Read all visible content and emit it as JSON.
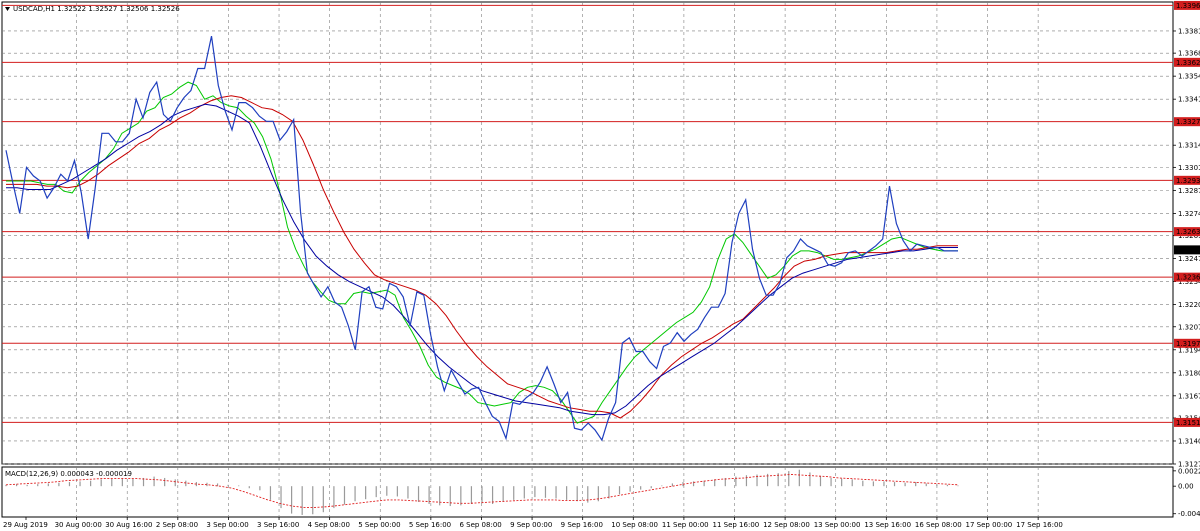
{
  "window": {
    "info": "USDCAD,H1  1.32522 1.32527 1.32506 1.32526",
    "menu_icon": "triangle-down-icon"
  },
  "colors": {
    "price": "#1f3fbf",
    "ma_fast": "#00c800",
    "ma_mid": "#c80000",
    "ma_slow": "#0000a0",
    "hline": "#d21e1e",
    "grid": "#7f7f7f",
    "label_bg": "#d21e1e",
    "current_bg": "#000000",
    "macd": "#9a9a9a",
    "macd_signal": "#e02020"
  },
  "chart_data": [
    {
      "type": "line",
      "symbol": "USDCAD",
      "timeframe": "H1",
      "ohlc": {
        "open": 1.32522,
        "high": 1.32527,
        "low": 1.32506,
        "close": 1.32526
      },
      "ylim": [
        1.3127,
        1.3398
      ],
      "y_ticks": [
        1.3381,
        1.3368,
        1.33545,
        1.3341,
        1.3314,
        1.3301,
        1.32875,
        1.3274,
        1.3261,
        1.32475,
        1.3234,
        1.32205,
        1.32075,
        1.3194,
        1.31805,
        1.3167,
        1.3154,
        1.31405,
        1.3127
      ],
      "y_tick_labels": [
        "1.33810",
        "1.33680",
        "1.33545",
        "1.33410",
        "1.33140",
        "1.33010",
        "1.32875",
        "1.32740",
        "1.32610",
        "1.32475",
        "1.32340",
        "1.32205",
        "1.32075",
        "1.31940",
        "1.31805",
        "1.31670",
        "1.31540",
        "1.31405",
        "1.31270"
      ],
      "x_labels": [
        "29 Aug 2019",
        "30 Aug 00:00",
        "30 Aug 16:00",
        "2 Sep 08:00",
        "3 Sep 00:00",
        "3 Sep 16:00",
        "4 Sep 08:00",
        "5 Sep 00:00",
        "5 Sep 16:00",
        "6 Sep 08:00",
        "9 Sep 00:00",
        "9 Sep 16:00",
        "10 Sep 08:00",
        "11 Sep 00:00",
        "11 Sep 16:00",
        "12 Sep 08:00",
        "13 Sep 00:00",
        "13 Sep 16:00",
        "16 Sep 08:00",
        "17 Sep 00:00",
        "17 Sep 16:00"
      ],
      "horizontal_levels": [
        {
          "value": 1.3396,
          "label": "1.33960"
        },
        {
          "value": 1.33626,
          "label": "1.33626"
        },
        {
          "value": 1.33278,
          "label": "1.33278"
        },
        {
          "value": 1.32934,
          "label": "1.32934"
        },
        {
          "value": 1.32633,
          "label": "1.32633"
        },
        {
          "value": 1.32366,
          "label": "1.32366"
        },
        {
          "value": 1.31978,
          "label": "1.31978"
        },
        {
          "value": 1.31514,
          "label": "1.31514"
        }
      ],
      "current_price": {
        "value": 1.32526,
        "label": "1.32526"
      },
      "series": [
        {
          "role": "price",
          "values": [
            1.3311,
            1.3292,
            1.3274,
            1.3301,
            1.3296,
            1.3293,
            1.3283,
            1.3289,
            1.3297,
            1.3293,
            1.3305,
            1.3286,
            1.3259,
            1.3288,
            1.3321,
            1.3321,
            1.3316,
            1.3316,
            1.3321,
            1.3341,
            1.333,
            1.3345,
            1.3351,
            1.3332,
            1.3328,
            1.3336,
            1.3342,
            1.3346,
            1.3359,
            1.3359,
            1.3378,
            1.3349,
            1.3334,
            1.3323,
            1.3339,
            1.3339,
            1.3336,
            1.3331,
            1.3328,
            1.3328,
            1.3317,
            1.3322,
            1.3329,
            1.3275,
            1.3239,
            1.3232,
            1.3225,
            1.3231,
            1.3222,
            1.3219,
            1.3208,
            1.3194,
            1.3228,
            1.3231,
            1.3219,
            1.3218,
            1.3233,
            1.3231,
            1.3225,
            1.3208,
            1.3228,
            1.3226,
            1.3203,
            1.3184,
            1.317,
            1.3182,
            1.3175,
            1.3168,
            1.3171,
            1.3172,
            1.3163,
            1.3155,
            1.3152,
            1.3142,
            1.3163,
            1.3162,
            1.3166,
            1.3169,
            1.3175,
            1.3184,
            1.3174,
            1.3163,
            1.3169,
            1.3148,
            1.3147,
            1.3151,
            1.3147,
            1.3141,
            1.3154,
            1.3163,
            1.3198,
            1.3201,
            1.3193,
            1.3193,
            1.3187,
            1.3183,
            1.3196,
            1.3198,
            1.3204,
            1.3199,
            1.3203,
            1.3206,
            1.3213,
            1.3219,
            1.3219,
            1.3227,
            1.3257,
            1.3274,
            1.3282,
            1.3253,
            1.3236,
            1.3226,
            1.3226,
            1.3233,
            1.3248,
            1.3252,
            1.3259,
            1.3255,
            1.3253,
            1.3251,
            1.3244,
            1.3243,
            1.3245,
            1.3251,
            1.3252,
            1.3249,
            1.3252,
            1.3255,
            1.3259,
            1.329,
            1.3268,
            1.3258,
            1.3252,
            1.3256,
            1.3255,
            1.3254,
            1.3254,
            1.3252,
            1.3252,
            1.3252
          ]
        },
        {
          "role": "ma_fast",
          "values": [
            1.3293,
            1.3293,
            1.3293,
            1.3293,
            1.3292,
            1.3291,
            1.3291,
            1.3287,
            1.3286,
            1.3293,
            1.3298,
            1.3302,
            1.3306,
            1.3312,
            1.3321,
            1.3324,
            1.3327,
            1.3334,
            1.3336,
            1.3342,
            1.3344,
            1.3348,
            1.3351,
            1.3349,
            1.3341,
            1.3343,
            1.3339,
            1.3337,
            1.3336,
            1.3331,
            1.3327,
            1.3319,
            1.3306,
            1.3288,
            1.3266,
            1.3253,
            1.3243,
            1.3234,
            1.3228,
            1.3223,
            1.3221,
            1.3221,
            1.3227,
            1.3228,
            1.3227,
            1.3228,
            1.3229,
            1.3226,
            1.3213,
            1.3205,
            1.3196,
            1.3185,
            1.3178,
            1.3175,
            1.3173,
            1.3171,
            1.3168,
            1.3163,
            1.3162,
            1.3161,
            1.3162,
            1.3163,
            1.3169,
            1.3172,
            1.3173,
            1.3172,
            1.317,
            1.3165,
            1.3158,
            1.3151,
            1.3153,
            1.3155,
            1.3163,
            1.317,
            1.3177,
            1.3184,
            1.319,
            1.3194,
            1.3198,
            1.3202,
            1.3206,
            1.321,
            1.3213,
            1.3216,
            1.3222,
            1.3231,
            1.3247,
            1.3259,
            1.3262,
            1.3257,
            1.325,
            1.3243,
            1.3236,
            1.3238,
            1.3243,
            1.3249,
            1.3252,
            1.3252,
            1.3251,
            1.3249,
            1.3247,
            1.3247,
            1.3248,
            1.3249,
            1.3251,
            1.3253,
            1.3256,
            1.3259,
            1.326,
            1.3258,
            1.3256,
            1.3254,
            1.3253,
            1.3252,
            1.3252,
            1.3252
          ]
        },
        {
          "role": "ma_mid",
          "values": [
            1.3291,
            1.3291,
            1.3291,
            1.3291,
            1.329,
            1.329,
            1.3289,
            1.329,
            1.3293,
            1.3297,
            1.3302,
            1.3306,
            1.331,
            1.3315,
            1.3318,
            1.3323,
            1.3326,
            1.333,
            1.3333,
            1.3337,
            1.334,
            1.3342,
            1.3343,
            1.3342,
            1.3339,
            1.3336,
            1.3335,
            1.3332,
            1.3328,
            1.3317,
            1.3303,
            1.3288,
            1.3275,
            1.3263,
            1.3253,
            1.3245,
            1.3238,
            1.3235,
            1.3233,
            1.3231,
            1.3229,
            1.3226,
            1.3221,
            1.3214,
            1.3205,
            1.3197,
            1.319,
            1.3184,
            1.3179,
            1.3174,
            1.3172,
            1.317,
            1.3167,
            1.3164,
            1.3162,
            1.316,
            1.3159,
            1.3158,
            1.3158,
            1.3157,
            1.3154,
            1.3158,
            1.3164,
            1.3171,
            1.3179,
            1.3185,
            1.319,
            1.3194,
            1.3198,
            1.3201,
            1.3205,
            1.3209,
            1.3212,
            1.3218,
            1.3224,
            1.323,
            1.3237,
            1.3243,
            1.3246,
            1.3247,
            1.3249,
            1.325,
            1.3251,
            1.3251,
            1.3251,
            1.3251,
            1.3251,
            1.3252,
            1.3253,
            1.3253,
            1.3254,
            1.3255,
            1.3255,
            1.3255
          ]
        },
        {
          "role": "ma_slow",
          "values": [
            1.3289,
            1.3289,
            1.3288,
            1.3288,
            1.3288,
            1.3291,
            1.3294,
            1.3298,
            1.3302,
            1.3306,
            1.3311,
            1.3315,
            1.3319,
            1.3322,
            1.3326,
            1.3331,
            1.3334,
            1.3336,
            1.3338,
            1.3337,
            1.3334,
            1.3331,
            1.3327,
            1.3313,
            1.3297,
            1.3282,
            1.3269,
            1.3258,
            1.3249,
            1.3243,
            1.3238,
            1.3234,
            1.3231,
            1.3228,
            1.3225,
            1.322,
            1.3213,
            1.3205,
            1.3197,
            1.319,
            1.3184,
            1.3179,
            1.3174,
            1.317,
            1.3168,
            1.3166,
            1.3164,
            1.3163,
            1.3162,
            1.3161,
            1.316,
            1.3158,
            1.3157,
            1.3156,
            1.3156,
            1.3157,
            1.3161,
            1.3167,
            1.3173,
            1.3178,
            1.3182,
            1.3186,
            1.319,
            1.3194,
            1.3198,
            1.3203,
            1.3208,
            1.3214,
            1.322,
            1.3226,
            1.3231,
            1.3236,
            1.3239,
            1.3241,
            1.3243,
            1.3245,
            1.3247,
            1.3248,
            1.3249,
            1.325,
            1.3251,
            1.3252,
            1.3252,
            1.3253,
            1.3254,
            1.3254,
            1.3254
          ]
        }
      ]
    },
    {
      "type": "bar",
      "title": "MACD(12,26,9) 0.000043 -0.000019",
      "ylim": [
        -0.0045,
        0.0028
      ],
      "y_ticks": [
        0.002238,
        0.0,
        -0.004022
      ],
      "y_tick_labels": [
        "0.002238",
        "0.00",
        "-0.004022"
      ],
      "series": [
        {
          "role": "histogram",
          "values": [
            0.0002,
            0.0003,
            0.0002,
            0.0003,
            0.0004,
            0.0005,
            0.0006,
            0.0007,
            0.0008,
            0.001,
            0.0011,
            0.0012,
            0.0011,
            0.0012,
            0.0014,
            0.0012,
            0.001,
            0.0008,
            0.0006,
            0.0005,
            0.0004,
            0.0002,
            0.0001,
            -0.0003,
            -0.0006,
            -0.002,
            -0.0032,
            -0.004,
            -0.0042,
            -0.0041,
            -0.0038,
            -0.0032,
            -0.0027,
            -0.0022,
            -0.0019,
            -0.0016,
            -0.0014,
            -0.0015,
            -0.0018,
            -0.0023,
            -0.0026,
            -0.0028,
            -0.0029,
            -0.0028,
            -0.0026,
            -0.0025,
            -0.0026,
            -0.0023,
            -0.002,
            -0.0018,
            -0.0016,
            -0.0017,
            -0.0018,
            -0.002,
            -0.0022,
            -0.0024,
            -0.0022,
            -0.0018,
            -0.0012,
            -0.0008,
            -0.0005,
            -0.0003,
            0.0001,
            0.0004,
            0.0006,
            0.0007,
            0.0008,
            0.001,
            0.0012,
            0.0014,
            0.0016,
            0.0017,
            0.0018,
            0.0019,
            0.0022,
            0.0024,
            0.002,
            0.0015,
            0.0012,
            0.0011,
            0.001,
            0.0008,
            0.0007,
            0.0007,
            0.0006,
            0.0005,
            0.0006,
            0.0004,
            0.0003,
            0.0002,
            0.0001
          ]
        },
        {
          "role": "signal",
          "values": [
            0.0002,
            0.0003,
            0.0004,
            0.0005,
            0.0006,
            0.0008,
            0.0009,
            0.001,
            0.0011,
            0.0011,
            0.0011,
            0.0011,
            0.001,
            0.0009,
            0.0007,
            0.0005,
            0.0003,
            0.0002,
            0.0,
            -0.0003,
            -0.0008,
            -0.0014,
            -0.002,
            -0.0025,
            -0.0029,
            -0.0031,
            -0.0031,
            -0.003,
            -0.0028,
            -0.0026,
            -0.0024,
            -0.0022,
            -0.002,
            -0.002,
            -0.0021,
            -0.0022,
            -0.0023,
            -0.0024,
            -0.0025,
            -0.0025,
            -0.0024,
            -0.0023,
            -0.0022,
            -0.0021,
            -0.002,
            -0.002,
            -0.002,
            -0.0021,
            -0.0021,
            -0.002,
            -0.0018,
            -0.0015,
            -0.0012,
            -0.0009,
            -0.0006,
            -0.0003,
            0.0,
            0.0003,
            0.0006,
            0.0008,
            0.001,
            0.0011,
            0.0012,
            0.0014,
            0.0015,
            0.0016,
            0.0017,
            0.0016,
            0.0015,
            0.0014,
            0.0012,
            0.0011,
            0.001,
            0.0009,
            0.0008,
            0.0007,
            0.0006,
            0.0005,
            0.0004,
            0.0003,
            0.0002
          ]
        }
      ]
    }
  ]
}
